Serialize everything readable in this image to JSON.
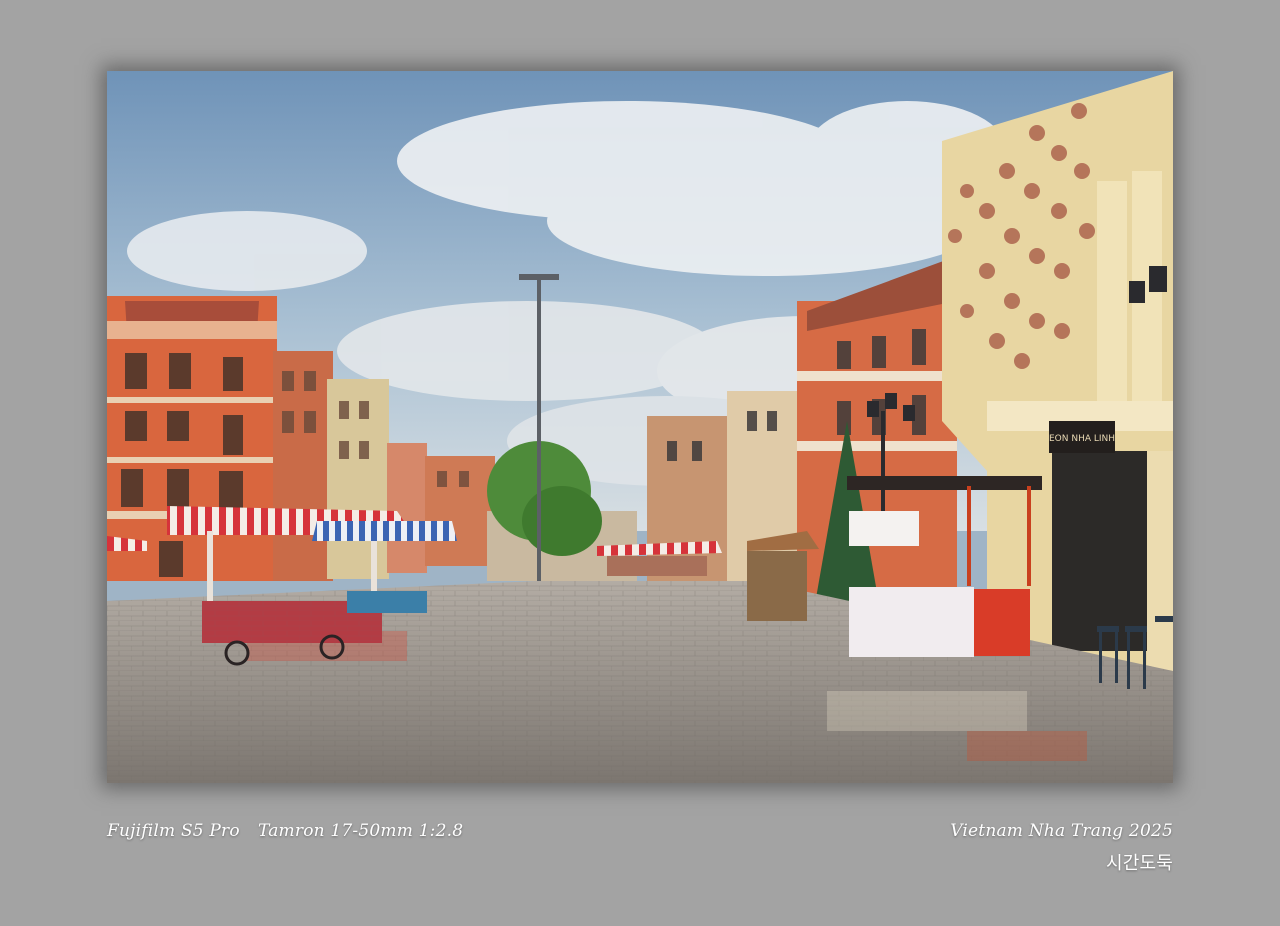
{
  "caption": {
    "camera": "Fujifilm S5 Pro",
    "lens": "Tamron 17-50mm 1:2.8",
    "location": "Vietnam Nha Trang 2025",
    "author": "시간도둑"
  },
  "signage": {
    "vertical_sign": "EON NHA LINH",
    "shop_sign": "EON NHA LINH"
  },
  "colors": {
    "background": "#a3a3a3",
    "sky": "#8fb0cc",
    "building_orange": "#d9663e",
    "awning_red": "#d23a3a",
    "pavement": "#8e8a86"
  }
}
